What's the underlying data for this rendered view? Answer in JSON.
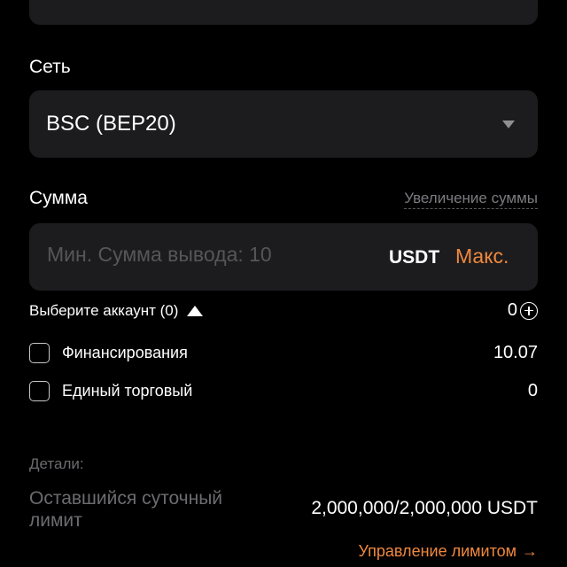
{
  "network": {
    "label": "Сеть",
    "value": "BSC (BEP20)"
  },
  "amount": {
    "label": "Сумма",
    "increase_link": "Увеличение суммы",
    "placeholder": "Мин. Сумма вывода: 10",
    "value": "",
    "currency": "USDT",
    "max_label": "Макс."
  },
  "accounts": {
    "select_label": "Выберите аккаунт (0)",
    "total": "0",
    "items": [
      {
        "name": "Финансирования",
        "value": "10.07"
      },
      {
        "name": "Единый торговый",
        "value": "0"
      }
    ]
  },
  "details": {
    "label": "Детали:",
    "daily_limit_label": "Оставшийся суточный лимит",
    "daily_limit_value": "2,000,000/2,000,000 USDT",
    "manage_link": "Управление лимитом",
    "manage_arrow": "→"
  },
  "colors": {
    "accent": "#f0883e",
    "field_bg": "#1c1c1e",
    "muted_text": "#6c6c70"
  }
}
